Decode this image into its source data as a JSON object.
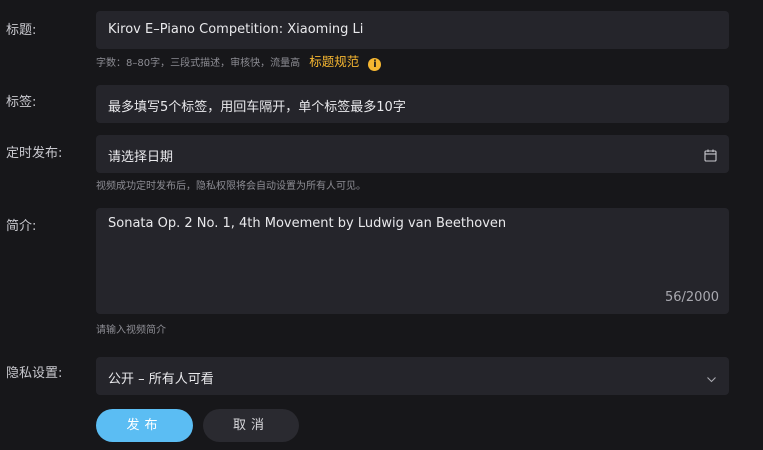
{
  "title_field": {
    "label": "标题:",
    "value": "Kirov E–Piano Competition: Xiaoming Li",
    "hint": "字数：8–80字，三段式描述，审核快，流量高",
    "rules_link": "标题规范",
    "rules_icon": "info-icon"
  },
  "tags_field": {
    "label": "标签:",
    "placeholder": "最多填写5个标签，用回车隔开，单个标签最多10字"
  },
  "schedule_field": {
    "label": "定时发布:",
    "placeholder": "请选择日期",
    "icon": "calendar-icon",
    "hint": "视频成功定时发布后，隐私权限将会自动设置为所有人可见。"
  },
  "description_field": {
    "label": "简介:",
    "value": "Sonata Op. 2 No. 1, 4th Movement by Ludwig van Beethoven",
    "counter": "56/2000",
    "hint": "请输入视频简介"
  },
  "privacy_field": {
    "label": "隐私设置:",
    "selected": "公开 – 所有人可看",
    "icon": "chevron-down-icon"
  },
  "actions": {
    "publish_label": "发布",
    "cancel_label": "取消"
  },
  "colors": {
    "background": "#17171a",
    "field_bg": "#25252b",
    "accent_orange": "#f5b631",
    "primary_button": "#5bbdf3"
  }
}
